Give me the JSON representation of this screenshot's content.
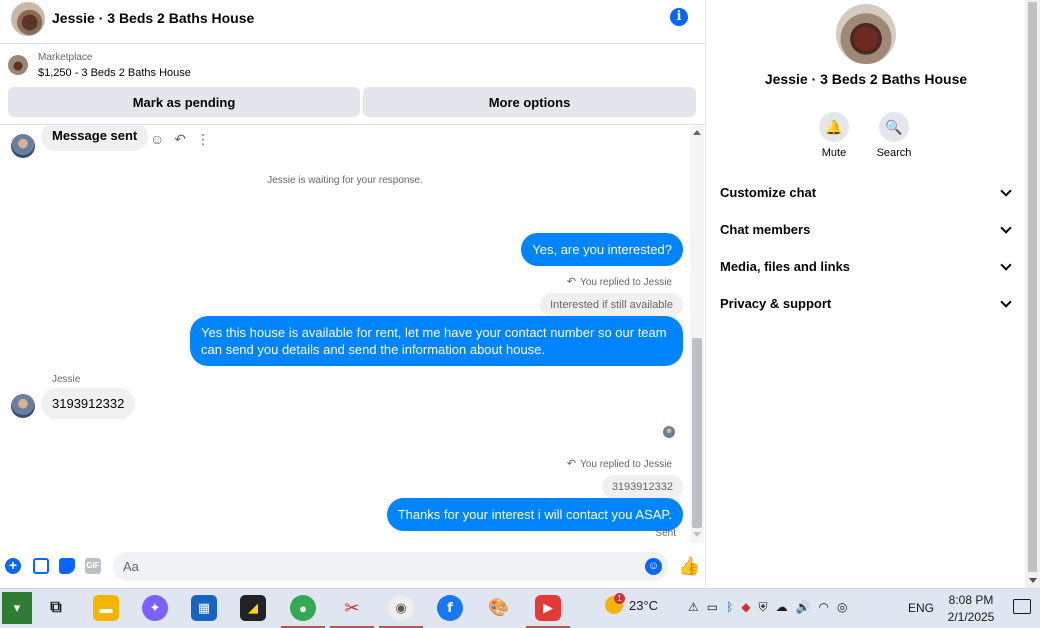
{
  "header": {
    "title": "Jessie · 3 Beds 2 Baths House",
    "info_icon": "info-icon"
  },
  "listing": {
    "category": "Marketplace",
    "title": "$1,250 - 3 Beds 2 Baths House",
    "buttons": {
      "pending": "Mark as pending",
      "more": "More options"
    }
  },
  "messages": {
    "first_in": "Message sent",
    "waiting": "Jessie is waiting for your response.",
    "out1": "Yes, are you interested?",
    "replied1": "You replied to Jessie",
    "quote1": "Interested if still available",
    "out2": "Yes this house is  available for rent, let me have your contact number so our team can send you details and send the information about house.",
    "sender": "Jessie",
    "in_number": "3193912332",
    "replied2": "You replied to Jessie",
    "quote2": "3193912332",
    "out3": "Thanks for your interest i will contact you ASAP.",
    "status": "Sent"
  },
  "composer": {
    "placeholder": "Aa"
  },
  "side": {
    "title": "Jessie · 3 Beds 2 Baths House",
    "actions": [
      {
        "label": "Mute",
        "icon": "bell-icon"
      },
      {
        "label": "Search",
        "icon": "search-icon"
      }
    ],
    "sections": [
      "Customize chat",
      "Chat members",
      "Media, files and links",
      "Privacy & support"
    ]
  },
  "taskbar": {
    "weather": {
      "temp": "23°C",
      "badge": "1"
    },
    "lang": "ENG",
    "time": "8:08 PM",
    "date": "2/1/2025"
  },
  "colors": {
    "accent": "#0084ff",
    "brand": "#0866ff",
    "incoming": "#f0f0f0"
  }
}
